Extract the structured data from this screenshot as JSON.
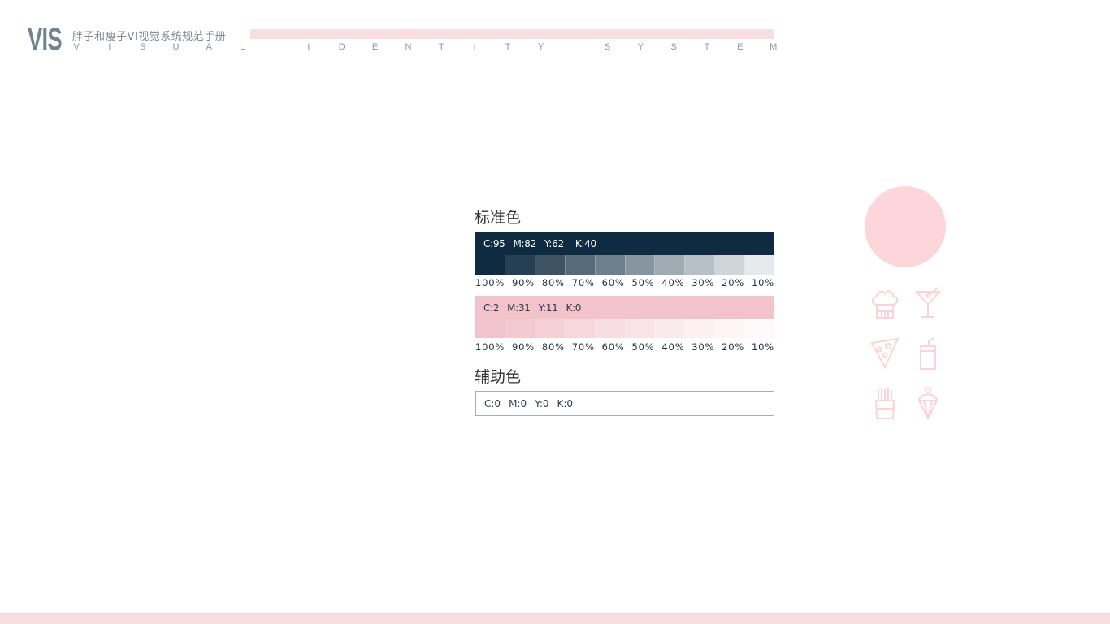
{
  "header": {
    "logo": "VIS",
    "title_cn": "胖子和瘦子VI视觉系统规范手册",
    "title_en_letters": [
      "V",
      "I",
      "S",
      "U",
      "A",
      "L",
      "",
      "I",
      "D",
      "E",
      "N",
      "T",
      "I",
      "T",
      "Y",
      "",
      "S",
      "Y",
      "S",
      "T",
      "E",
      "M"
    ]
  },
  "primary": {
    "title": "标准色",
    "color": "#0e2b41",
    "cmyk": [
      "C:95",
      "M:82",
      "Y:62",
      "K:40"
    ],
    "tints": [
      "#0e2b41",
      "#263f52",
      "#3e5464",
      "#566a7a",
      "#6e808d",
      "#8695a0",
      "#9fabb3",
      "#b7c0c6",
      "#cfd5d9",
      "#e7eaec"
    ],
    "percentages": [
      "100%",
      "90%",
      "80%",
      "70%",
      "60%",
      "50%",
      "40%",
      "30%",
      "20%",
      "10%"
    ]
  },
  "secondary": {
    "color": "#f2c3cb",
    "cmyk": [
      "C:2",
      "M:31",
      "Y:11",
      "K:0"
    ],
    "tints": [
      "#f2c3cb",
      "#f4cad1",
      "#f5d1d6",
      "#f7d7dc",
      "#f8dee2",
      "#fae3e7",
      "#fbeaed",
      "#fcf0f2",
      "#fdf5f6",
      "#fefafb"
    ],
    "percentages": [
      "100%",
      "90%",
      "80%",
      "70%",
      "60%",
      "50%",
      "40%",
      "30%",
      "20%",
      "10%"
    ]
  },
  "auxiliary": {
    "title": "辅助色",
    "color": "#ffffff",
    "cmyk": [
      "C:0",
      "M:0",
      "Y:0",
      "K:0"
    ]
  },
  "decor": {
    "accent": "#fdd6dc",
    "icons": [
      "chef-hat-icon",
      "cocktail-icon",
      "pizza-slice-icon",
      "soda-cup-icon",
      "french-fries-icon",
      "ice-cream-icon"
    ]
  }
}
